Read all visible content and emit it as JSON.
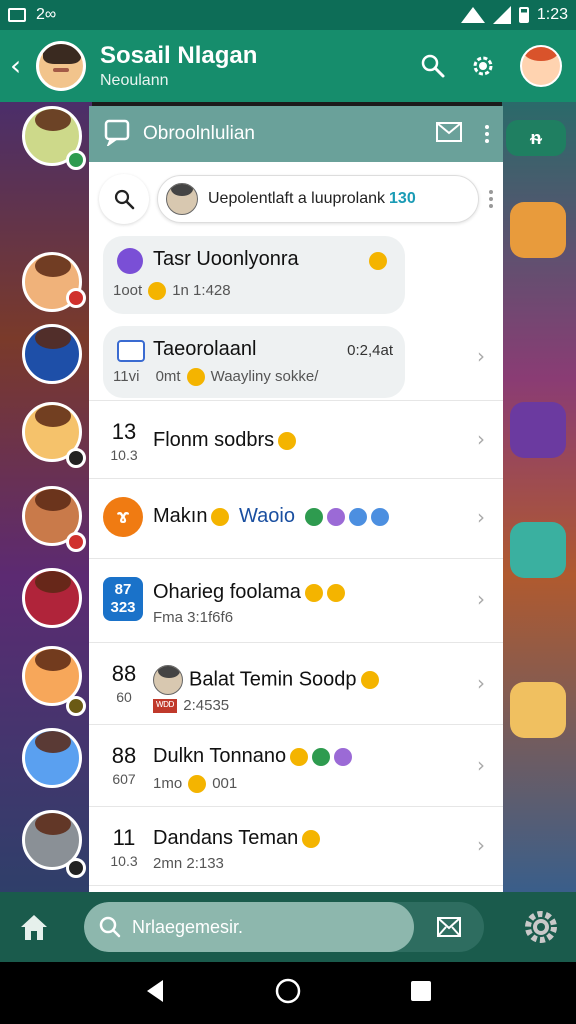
{
  "status_bar": {
    "left_text": "2∞",
    "time": "1:23"
  },
  "app_bar": {
    "title": "Sosail Nlagan",
    "subtitle": "Neoulann"
  },
  "panel": {
    "title": "Obroolnlulian",
    "search": {
      "text": "Uepolentlaft a luuprolank",
      "count": "130"
    },
    "bubbles": [
      {
        "title": "Tasr Uoonlyonra",
        "sub": "1oot",
        "time": "1n 1:428"
      },
      {
        "title": "Taeorolaanl",
        "sub": "11vi",
        "time": "0mt",
        "status": "Waayliny sokke/",
        "right": "0:2,4at"
      }
    ],
    "rows": [
      {
        "lead": "13",
        "lead_sub": "10.3",
        "title": "Flonm sodbrs"
      },
      {
        "lead": "ɤ",
        "title": "Makın",
        "extra": "Waoio"
      },
      {
        "lead_top": "87",
        "lead_bottom": "323",
        "title": "Oharieg foolama",
        "sub": "Fma 3:1f6f6"
      },
      {
        "lead": "88",
        "lead_sub": "60",
        "title": "Balat Temin Soodp",
        "sub": "2:4535"
      },
      {
        "lead": "88",
        "lead_sub": "607",
        "title": "Dulkn Tonnano",
        "sub": "1mo",
        "sub2": "001"
      },
      {
        "lead": "11",
        "lead_sub": "10.3",
        "title": "Dandans Teman",
        "sub": "2mn 2:133"
      }
    ]
  },
  "bottom_bar": {
    "search_placeholder": "Nrlaegemesir."
  },
  "chat_chip": "ᵰ"
}
